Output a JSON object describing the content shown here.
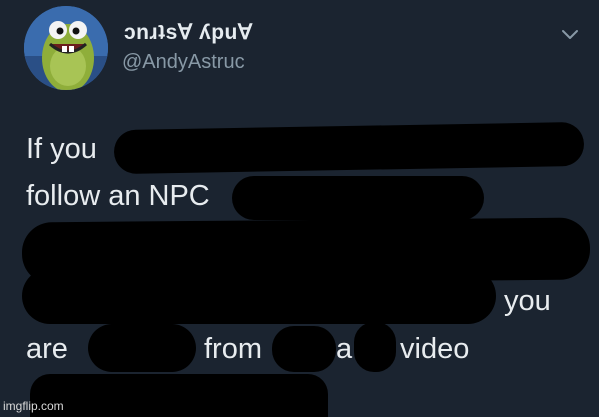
{
  "tweet": {
    "display_name": "ɔnɹʇs∀ ʎpu∀",
    "handle": "@AndyAstruc",
    "avatar_icon": "fish-cartoon-avatar",
    "menu_icon": "chevron-down-icon",
    "body": {
      "line1": "If you",
      "line2": "follow an NPC",
      "line4": "you",
      "line5_a": "are",
      "line5_b": "from",
      "line5_c": "a",
      "line5_d": "video"
    }
  },
  "watermark": "imgflip.com",
  "colors": {
    "background": "#1b2430",
    "text": "#e8ecef",
    "secondary_text": "#8899a6",
    "redaction": "#000000"
  }
}
